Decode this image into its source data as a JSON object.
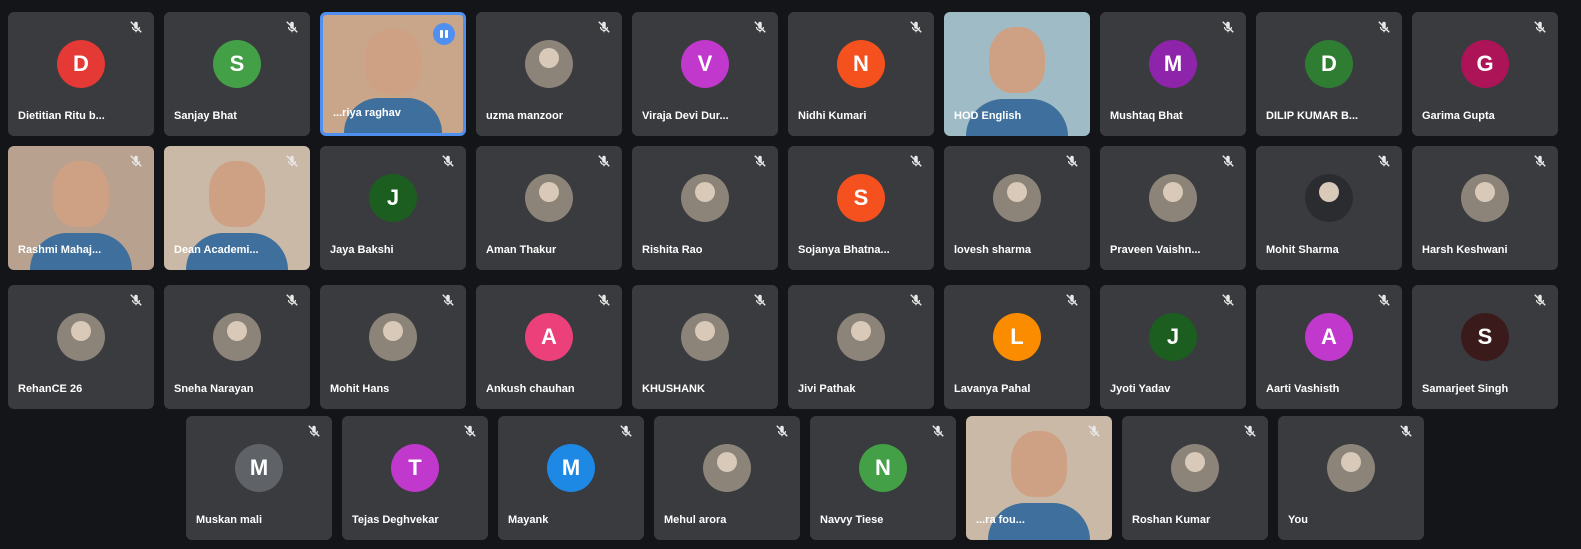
{
  "participants": [
    {
      "name": "Dietitian Ritu b...",
      "initial": "D",
      "color": "#e53935",
      "type": "avatar",
      "muted": true
    },
    {
      "name": "Sanjay Bhat",
      "initial": "S",
      "color": "#43a047",
      "type": "avatar",
      "muted": true
    },
    {
      "name": "...riya raghav",
      "initial": "",
      "color": "#c9a58a",
      "type": "video",
      "muted": false,
      "speaking": true
    },
    {
      "name": "uzma manzoor",
      "initial": "",
      "color": "#8c8479",
      "type": "photo",
      "muted": true
    },
    {
      "name": "Viraja Devi Dur...",
      "initial": "V",
      "color": "#c038cc",
      "type": "avatar",
      "muted": true
    },
    {
      "name": "Nidhi Kumari",
      "initial": "N",
      "color": "#f4511e",
      "type": "avatar",
      "muted": true
    },
    {
      "name": "HOD English",
      "initial": "",
      "color": "#9fbcc6",
      "type": "video",
      "muted": false
    },
    {
      "name": "Mushtaq Bhat",
      "initial": "M",
      "color": "#8e24aa",
      "type": "avatar",
      "muted": true
    },
    {
      "name": "DILIP KUMAR B...",
      "initial": "D",
      "color": "#2e7d32",
      "type": "avatar",
      "muted": true
    },
    {
      "name": "Garima Gupta",
      "initial": "G",
      "color": "#ad1457",
      "type": "avatar",
      "muted": true
    },
    {
      "name": "Rashmi Mahaj...",
      "initial": "",
      "color": "#b9a18f",
      "type": "video",
      "muted": true
    },
    {
      "name": "Dean Academi...",
      "initial": "",
      "color": "#c9b9a6",
      "type": "video",
      "muted": true
    },
    {
      "name": "Jaya Bakshi",
      "initial": "J",
      "color": "#1b5e20",
      "type": "avatar",
      "muted": true
    },
    {
      "name": "Aman Thakur",
      "initial": "",
      "color": "#8c8479",
      "type": "photo",
      "muted": true
    },
    {
      "name": "Rishita Rao",
      "initial": "",
      "color": "#8c8479",
      "type": "photo",
      "muted": true
    },
    {
      "name": "Sojanya Bhatna...",
      "initial": "S",
      "color": "#f4511e",
      "type": "avatar",
      "muted": true
    },
    {
      "name": "lovesh sharma",
      "initial": "",
      "color": "#8c8479",
      "type": "photo",
      "muted": true
    },
    {
      "name": "Praveen Vaishn...",
      "initial": "",
      "color": "#8c8479",
      "type": "photo",
      "muted": true
    },
    {
      "name": "Mohit Sharma",
      "initial": "",
      "color": "#2b2c30",
      "type": "photo",
      "muted": true
    },
    {
      "name": "Harsh Keshwani",
      "initial": "",
      "color": "#8c8479",
      "type": "photo",
      "muted": true
    },
    {
      "name": "RehanCE 26",
      "initial": "",
      "color": "#8c8479",
      "type": "photo",
      "muted": true
    },
    {
      "name": "Sneha Narayan",
      "initial": "",
      "color": "#8c8479",
      "type": "photo",
      "muted": true
    },
    {
      "name": "Mohit Hans",
      "initial": "",
      "color": "#8c8479",
      "type": "photo",
      "muted": true
    },
    {
      "name": "Ankush chauhan",
      "initial": "A",
      "color": "#ec407a",
      "type": "avatar",
      "muted": true
    },
    {
      "name": "KHUSHANK",
      "initial": "",
      "color": "#8c8479",
      "type": "photo",
      "muted": true
    },
    {
      "name": "Jivi Pathak",
      "initial": "",
      "color": "#8c8479",
      "type": "photo",
      "muted": true
    },
    {
      "name": "Lavanya Pahal",
      "initial": "L",
      "color": "#fb8c00",
      "type": "avatar",
      "muted": true
    },
    {
      "name": "Jyoti Yadav",
      "initial": "J",
      "color": "#1b5e20",
      "type": "avatar",
      "muted": true
    },
    {
      "name": "Aarti Vashisth",
      "initial": "A",
      "color": "#c038cc",
      "type": "avatar",
      "muted": true
    },
    {
      "name": "Samarjeet Singh",
      "initial": "S",
      "color": "#3a1a1a",
      "type": "avatar",
      "muted": true
    },
    {
      "name": "Muskan mali",
      "initial": "M",
      "color": "#5f6368",
      "type": "avatar",
      "muted": true
    },
    {
      "name": "Tejas Deghvekar",
      "initial": "T",
      "color": "#c038cc",
      "type": "avatar",
      "muted": true
    },
    {
      "name": "Mayank",
      "initial": "M",
      "color": "#1e88e5",
      "type": "avatar",
      "muted": true
    },
    {
      "name": "Mehul arora",
      "initial": "",
      "color": "#8c8479",
      "type": "photo",
      "muted": true
    },
    {
      "name": "Navvy Tiese",
      "initial": "N",
      "color": "#43a047",
      "type": "avatar",
      "muted": true
    },
    {
      "name": "...ra fou...",
      "initial": "",
      "color": "#c9b9a6",
      "type": "video",
      "muted": true
    },
    {
      "name": "Roshan Kumar",
      "initial": "",
      "color": "#8c8479",
      "type": "photo",
      "muted": true
    },
    {
      "name": "You",
      "initial": "",
      "color": "#8c8479",
      "type": "photo",
      "muted": true
    }
  ]
}
